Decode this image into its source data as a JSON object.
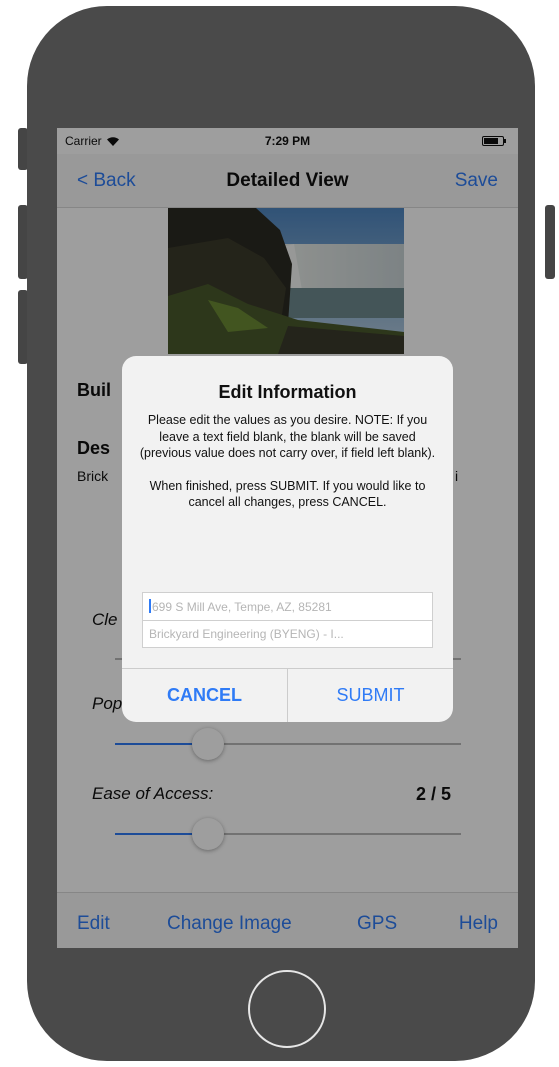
{
  "status_bar": {
    "carrier": "Carrier",
    "time": "7:29 PM"
  },
  "nav": {
    "back": "< Back",
    "title": "Detailed View",
    "save": "Save"
  },
  "content": {
    "building_label": "Buil",
    "description_label": "Des",
    "description_text": "Brick",
    "description_tail": "i",
    "cleanliness_label": "Cle",
    "popularity_label": "Pop",
    "ease_label": "Ease of Access:",
    "ease_rating": "2 / 5",
    "cleanliness_level": 0.0,
    "popularity_level": 0.27,
    "ease_level": 0.27
  },
  "tab_bar": {
    "edit": "Edit",
    "change_image": "Change Image",
    "gps": "GPS",
    "help": "Help"
  },
  "alert": {
    "title": "Edit Information",
    "message_1": "Please edit the values as you desire. NOTE: If you leave a text field blank, the blank will be saved (previous value does not carry over, if field left blank).",
    "message_2": "When finished, press SUBMIT. If you would like to cancel all changes, press CANCEL.",
    "field_1_placeholder": "699 S Mill Ave, Tempe, AZ, 85281",
    "field_2_placeholder": "Brickyard Engineering (BYENG) - I...",
    "cancel": "CANCEL",
    "submit": "SUBMIT"
  },
  "colors": {
    "accent": "#2f7bf6",
    "frame": "#4a4a4a"
  }
}
